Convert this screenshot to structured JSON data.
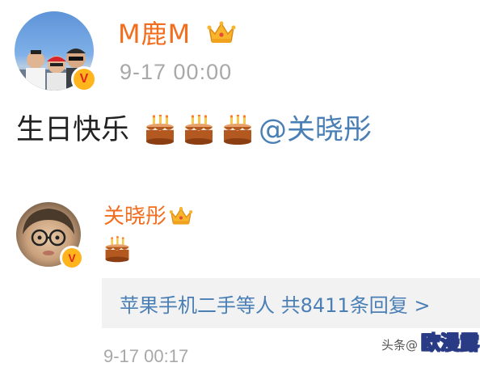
{
  "post": {
    "username": "M鹿M",
    "timestamp": "9-17 00:00",
    "text": "生日快乐",
    "cake_count": 3,
    "mention": "@关晓彤",
    "verified_badge": "V"
  },
  "comment": {
    "username": "关晓彤",
    "cake_count": 1,
    "verified_badge": "V",
    "reply_summary": "苹果手机二手等人  共8411条回复 >",
    "timestamp": "9-17 00:17"
  },
  "watermark": {
    "prefix": "头条@",
    "name": "欧漫露"
  },
  "colors": {
    "username": "#f26d1d",
    "link": "#4a7fb6",
    "timestamp": "#a8a8a8",
    "reply_bg": "#f2f2f2",
    "badge": "#ffb51b"
  }
}
